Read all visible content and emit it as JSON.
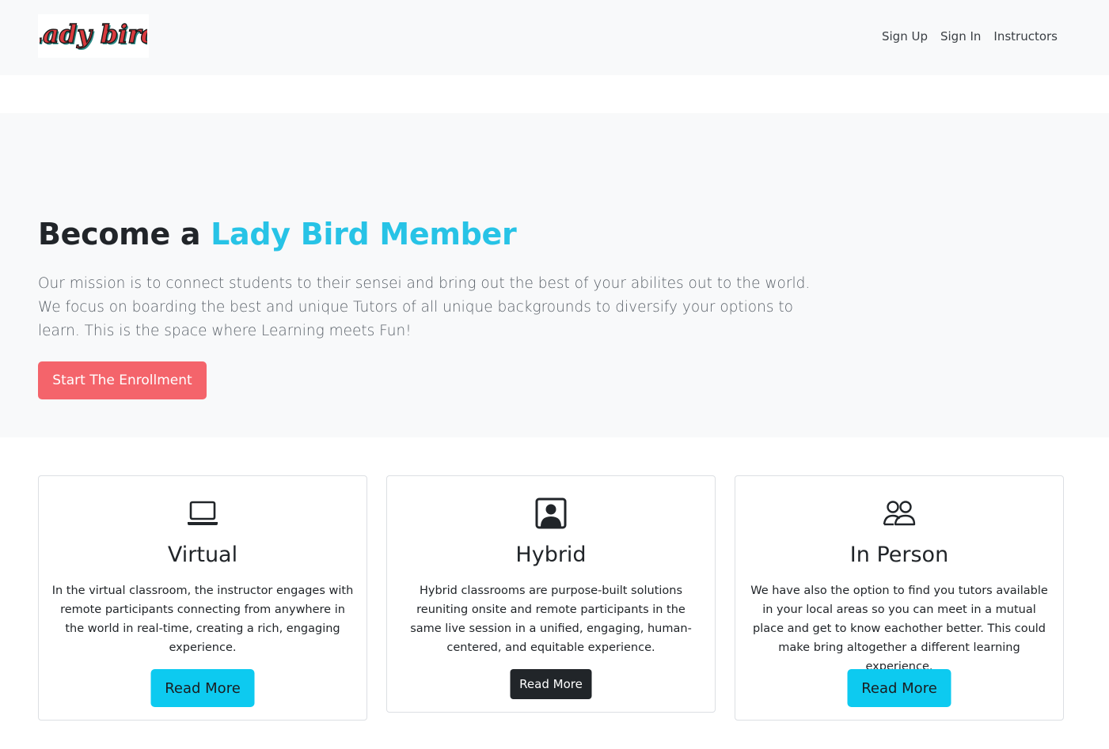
{
  "navbar": {
    "logo_text": "Lady bird",
    "links": [
      "Sign Up",
      "Sign In",
      "Instructors"
    ]
  },
  "hero": {
    "title_plain": "Become a ",
    "title_accent": "Lady Bird Member",
    "text": "Our mission is to connect students to their sensei and bring out the best of your abilites out to the world. We focus on boarding the best and unique Tutors of all unique backgrounds to diversify your options to learn. This is the space where Learning meets Fun!",
    "cta_label": "Start The Enrollment"
  },
  "cards": [
    {
      "icon": "laptop-icon",
      "title": "Virtual",
      "text": "In the virtual classroom, the instructor engages with remote participants connecting from anywhere in the world in real-time, creating a rich, engaging experience.",
      "button_label": "Read More"
    },
    {
      "icon": "person-square-icon",
      "title": "Hybrid",
      "text": "Hybrid classrooms are purpose-built solutions reuniting onsite and remote participants in the same live session in a unified, engaging, human-centered, and equitable experience.",
      "button_label": "Read More"
    },
    {
      "icon": "people-icon",
      "title": "In Person",
      "text": "We have also the option to find you tutors available in your local areas so you can meet in a mutual place and get to know eachother better. This could make bring altogether a different learning experience.",
      "button_label": "Read More"
    }
  ],
  "colors": {
    "accent": "#27c3e6",
    "cta": "#f4646b",
    "info_button": "#0dcaf0",
    "dark_button": "#212529",
    "logo_red": "#d93a3e"
  }
}
